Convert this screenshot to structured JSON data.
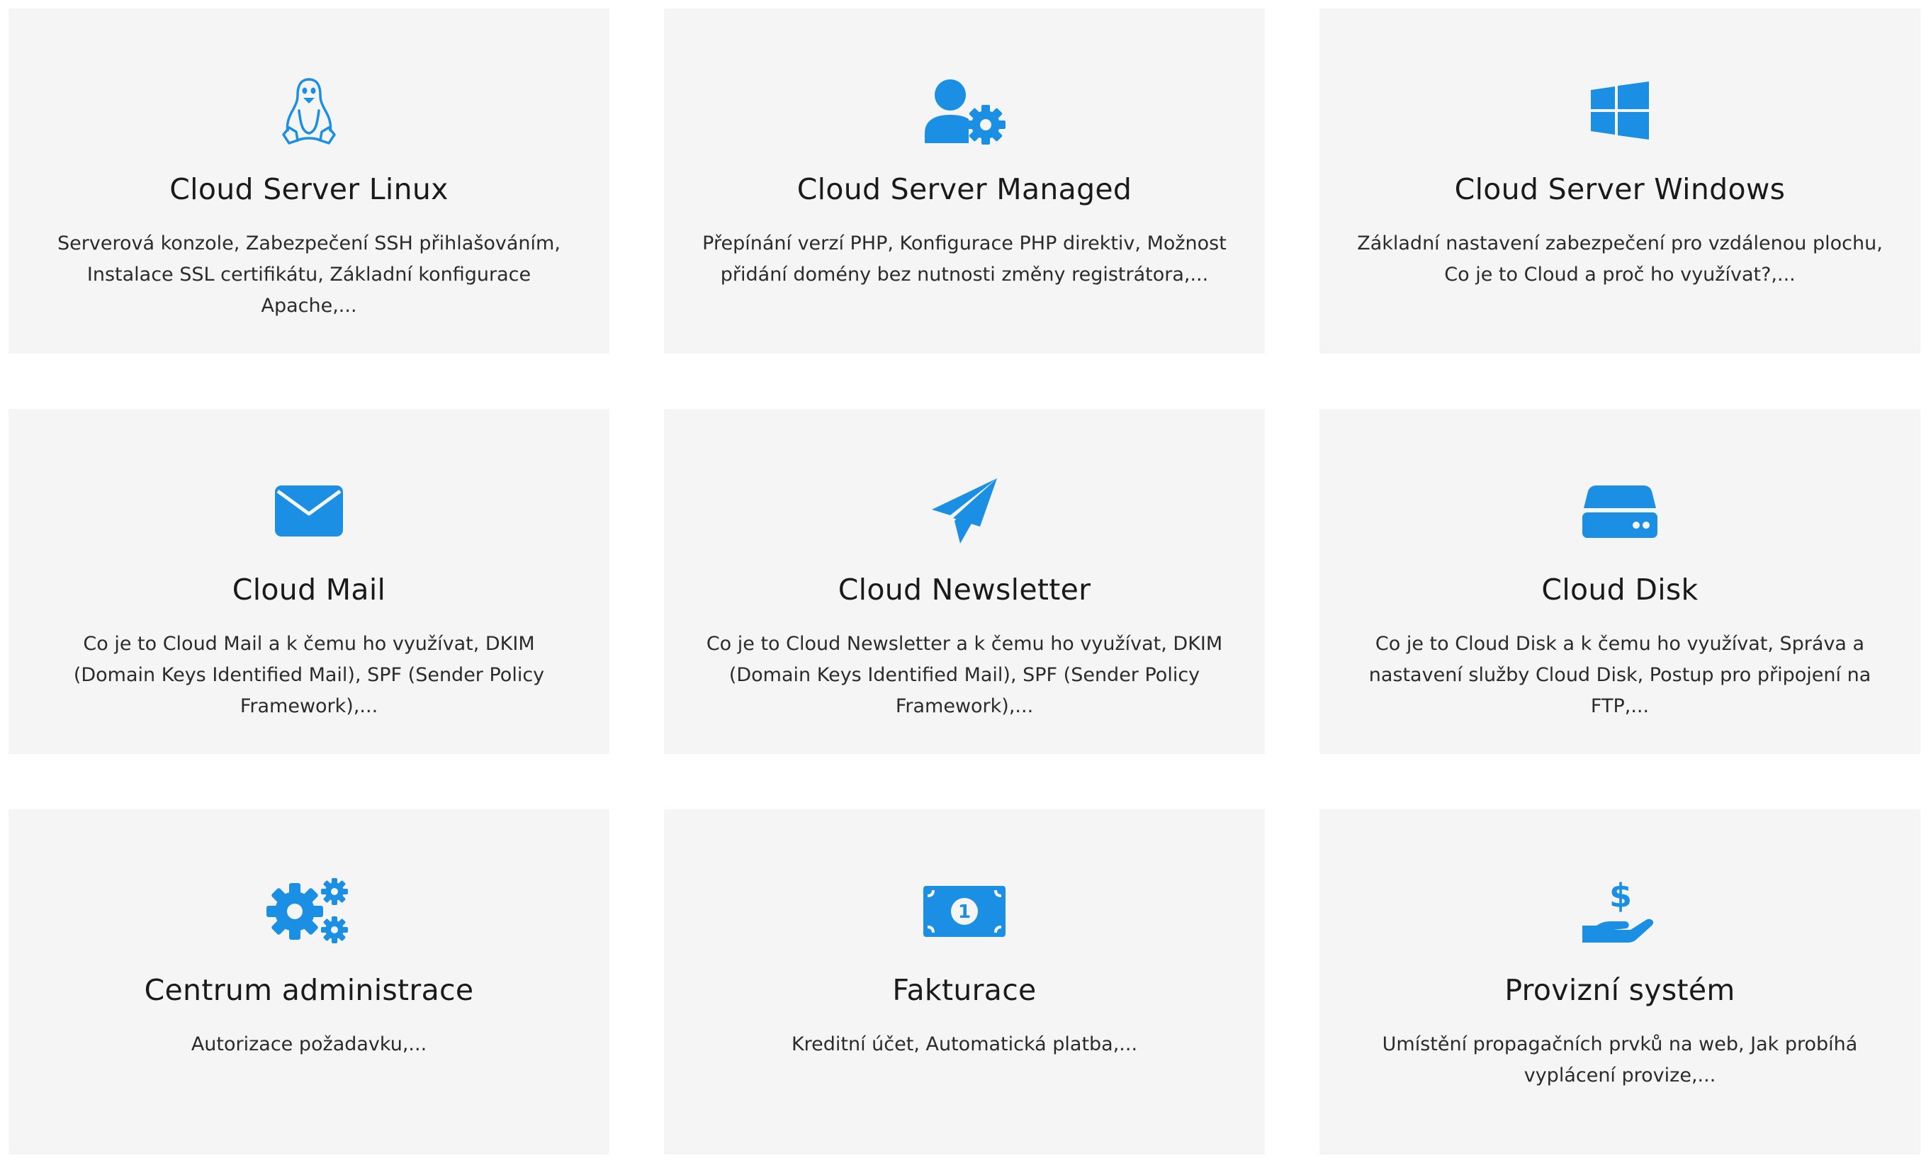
{
  "theme": {
    "accent": "#1a8fe3",
    "card_bg": "#f5f5f5",
    "text": "#1a1a1a"
  },
  "cards": [
    {
      "icon": "linux-penguin-icon",
      "title": "Cloud Server Linux",
      "description": "Serverová konzole, Zabezpečení SSH přihlašováním, Instalace SSL certifikátu, Základní konfigurace Apache,..."
    },
    {
      "icon": "user-gear-icon",
      "title": "Cloud Server Managed",
      "description": "Přepínání verzí PHP, Konfigurace PHP direktiv, Možnost přidání domény bez nutnosti změny registrátora,..."
    },
    {
      "icon": "windows-logo-icon",
      "title": "Cloud Server Windows",
      "description": "Základní nastavení zabezpečení pro vzdálenou plochu, Co je to Cloud a proč ho využívat?,..."
    },
    {
      "icon": "envelope-icon",
      "title": "Cloud Mail",
      "description": "Co je to Cloud Mail a k čemu ho využívat, DKIM (Domain Keys Identified Mail), SPF (Sender Policy Framework),..."
    },
    {
      "icon": "paper-plane-icon",
      "title": "Cloud Newsletter",
      "description": "Co je to Cloud Newsletter a k čemu ho využívat, DKIM (Domain Keys Identified Mail), SPF (Sender Policy Framework),..."
    },
    {
      "icon": "hard-drive-icon",
      "title": "Cloud Disk",
      "description": "Co je to Cloud Disk a k čemu ho využívat, Správa a nastavení služby Cloud Disk, Postup pro připojení na FTP,..."
    },
    {
      "icon": "gears-icon",
      "title": "Centrum administrace",
      "description": "Autorizace požadavku,..."
    },
    {
      "icon": "money-bill-icon",
      "title": "Fakturace",
      "description": "Kreditní účet, Automatická platba,..."
    },
    {
      "icon": "hand-holding-dollar-icon",
      "title": "Provizní systém",
      "description": "Umístění propagačních prvků na web, Jak probíhá vyplácení provize,..."
    }
  ]
}
